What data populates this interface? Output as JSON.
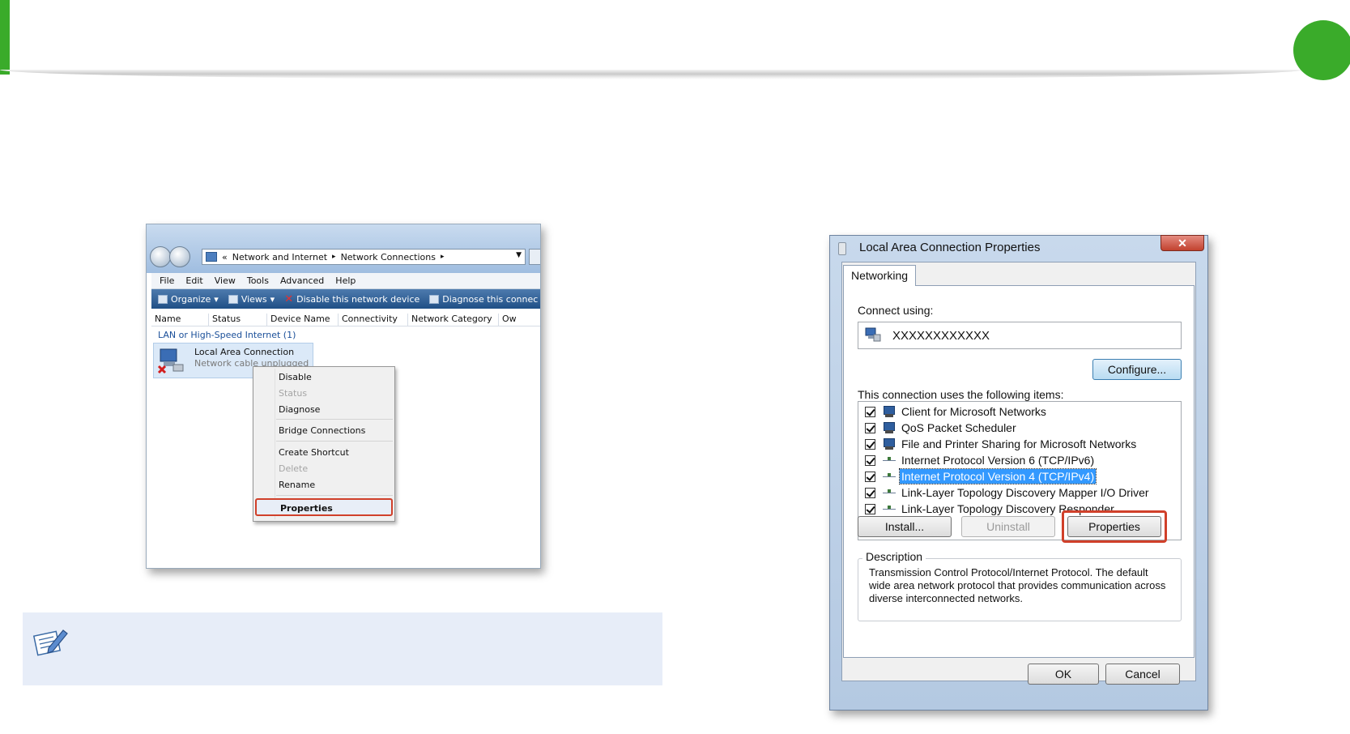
{
  "explorer": {
    "address": {
      "prefix": "«",
      "crumb1": "Network and Internet",
      "crumb2": "Network Connections",
      "sep": "▸"
    },
    "menubar": [
      "File",
      "Edit",
      "View",
      "Tools",
      "Advanced",
      "Help"
    ],
    "toolbar": {
      "organize": "Organize",
      "views": "Views",
      "disable": "Disable this network device",
      "diagnose": "Diagnose this connec"
    },
    "columns": [
      "Name",
      "Status",
      "Device Name",
      "Connectivity",
      "Network Category",
      "Ow"
    ],
    "group_label": "LAN or High-Speed Internet (1)",
    "connection": {
      "name": "Local Area Connection",
      "status": "Network cable unplugged"
    },
    "context_menu": {
      "disable": "Disable",
      "status": "Status",
      "diagnose": "Diagnose",
      "bridge": "Bridge Connections",
      "shortcut": "Create Shortcut",
      "delete": "Delete",
      "rename": "Rename",
      "properties": "Properties"
    }
  },
  "dialog": {
    "title": "Local Area Connection Properties",
    "close": "✕",
    "tab": "Networking",
    "connect_using_label": "Connect using:",
    "adapter_name": "XXXXXXXXXXXX",
    "configure": "Configure...",
    "items_label": "This connection uses the following items:",
    "items": [
      "Client for Microsoft Networks",
      "QoS Packet Scheduler",
      "File and Printer Sharing for Microsoft Networks",
      "Internet Protocol Version 6 (TCP/IPv6)",
      "Internet Protocol Version 4 (TCP/IPv4)",
      "Link-Layer Topology Discovery Mapper I/O Driver",
      "Link-Layer Topology Discovery Responder"
    ],
    "install": "Install...",
    "uninstall": "Uninstall",
    "properties": "Properties",
    "description_label": "Description",
    "description_text": "Transmission Control Protocol/Internet Protocol. The default wide area network protocol that provides communication across diverse interconnected networks.",
    "ok": "OK",
    "cancel": "Cancel"
  },
  "colors": {
    "accent_green": "#3aab2a",
    "highlight_red": "#d0402a",
    "selection_blue": "#3399ff"
  }
}
